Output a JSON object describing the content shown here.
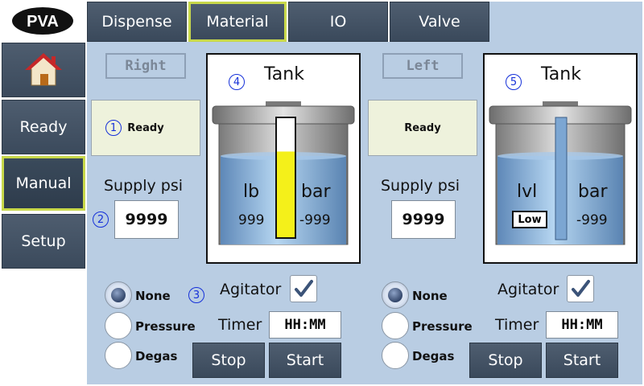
{
  "app": {
    "logo_text": "PVA"
  },
  "nav": {
    "items": [
      {
        "label": "Ready"
      },
      {
        "label": "Manual"
      },
      {
        "label": "Setup"
      }
    ]
  },
  "tabs": [
    {
      "label": "Dispense"
    },
    {
      "label": "Material"
    },
    {
      "label": "IO"
    },
    {
      "label": "Valve"
    }
  ],
  "colors": {
    "accent": "#c8d84a",
    "panel": "#b9cde3",
    "button": "#3f4e60",
    "callout": "#1631d9",
    "level_fill": "#f4f01a"
  },
  "right": {
    "side_label": "Right",
    "status": "Ready",
    "status_marker": "1",
    "supply_label": "Supply  psi",
    "supply_marker": "2",
    "supply_value": "9999",
    "tank_marker": "4",
    "tank_title": "Tank",
    "left_unit": "lb",
    "left_value": "999",
    "right_unit": "bar",
    "right_value": "-999",
    "level_fraction": 0.72,
    "radio_options": [
      "None",
      "Pressure",
      "Degas"
    ],
    "radio_selected": "None",
    "mode_marker": "3",
    "agitator_label": "Agitator",
    "agitator_checked": true,
    "timer_label": "Timer",
    "timer_value": "HH:MM",
    "stop_label": "Stop",
    "start_label": "Start"
  },
  "left": {
    "side_label": "Left",
    "status": "Ready",
    "supply_label": "Supply  psi",
    "supply_value": "9999",
    "tank_marker": "5",
    "tank_title": "Tank",
    "left_unit": "lvl",
    "low_badge": "Low",
    "right_unit": "bar",
    "right_value": "-999",
    "radio_options": [
      "None",
      "Pressure",
      "Degas"
    ],
    "radio_selected": "None",
    "agitator_label": "Agitator",
    "agitator_checked": true,
    "timer_label": "Timer",
    "timer_value": "HH:MM",
    "stop_label": "Stop",
    "start_label": "Start"
  }
}
